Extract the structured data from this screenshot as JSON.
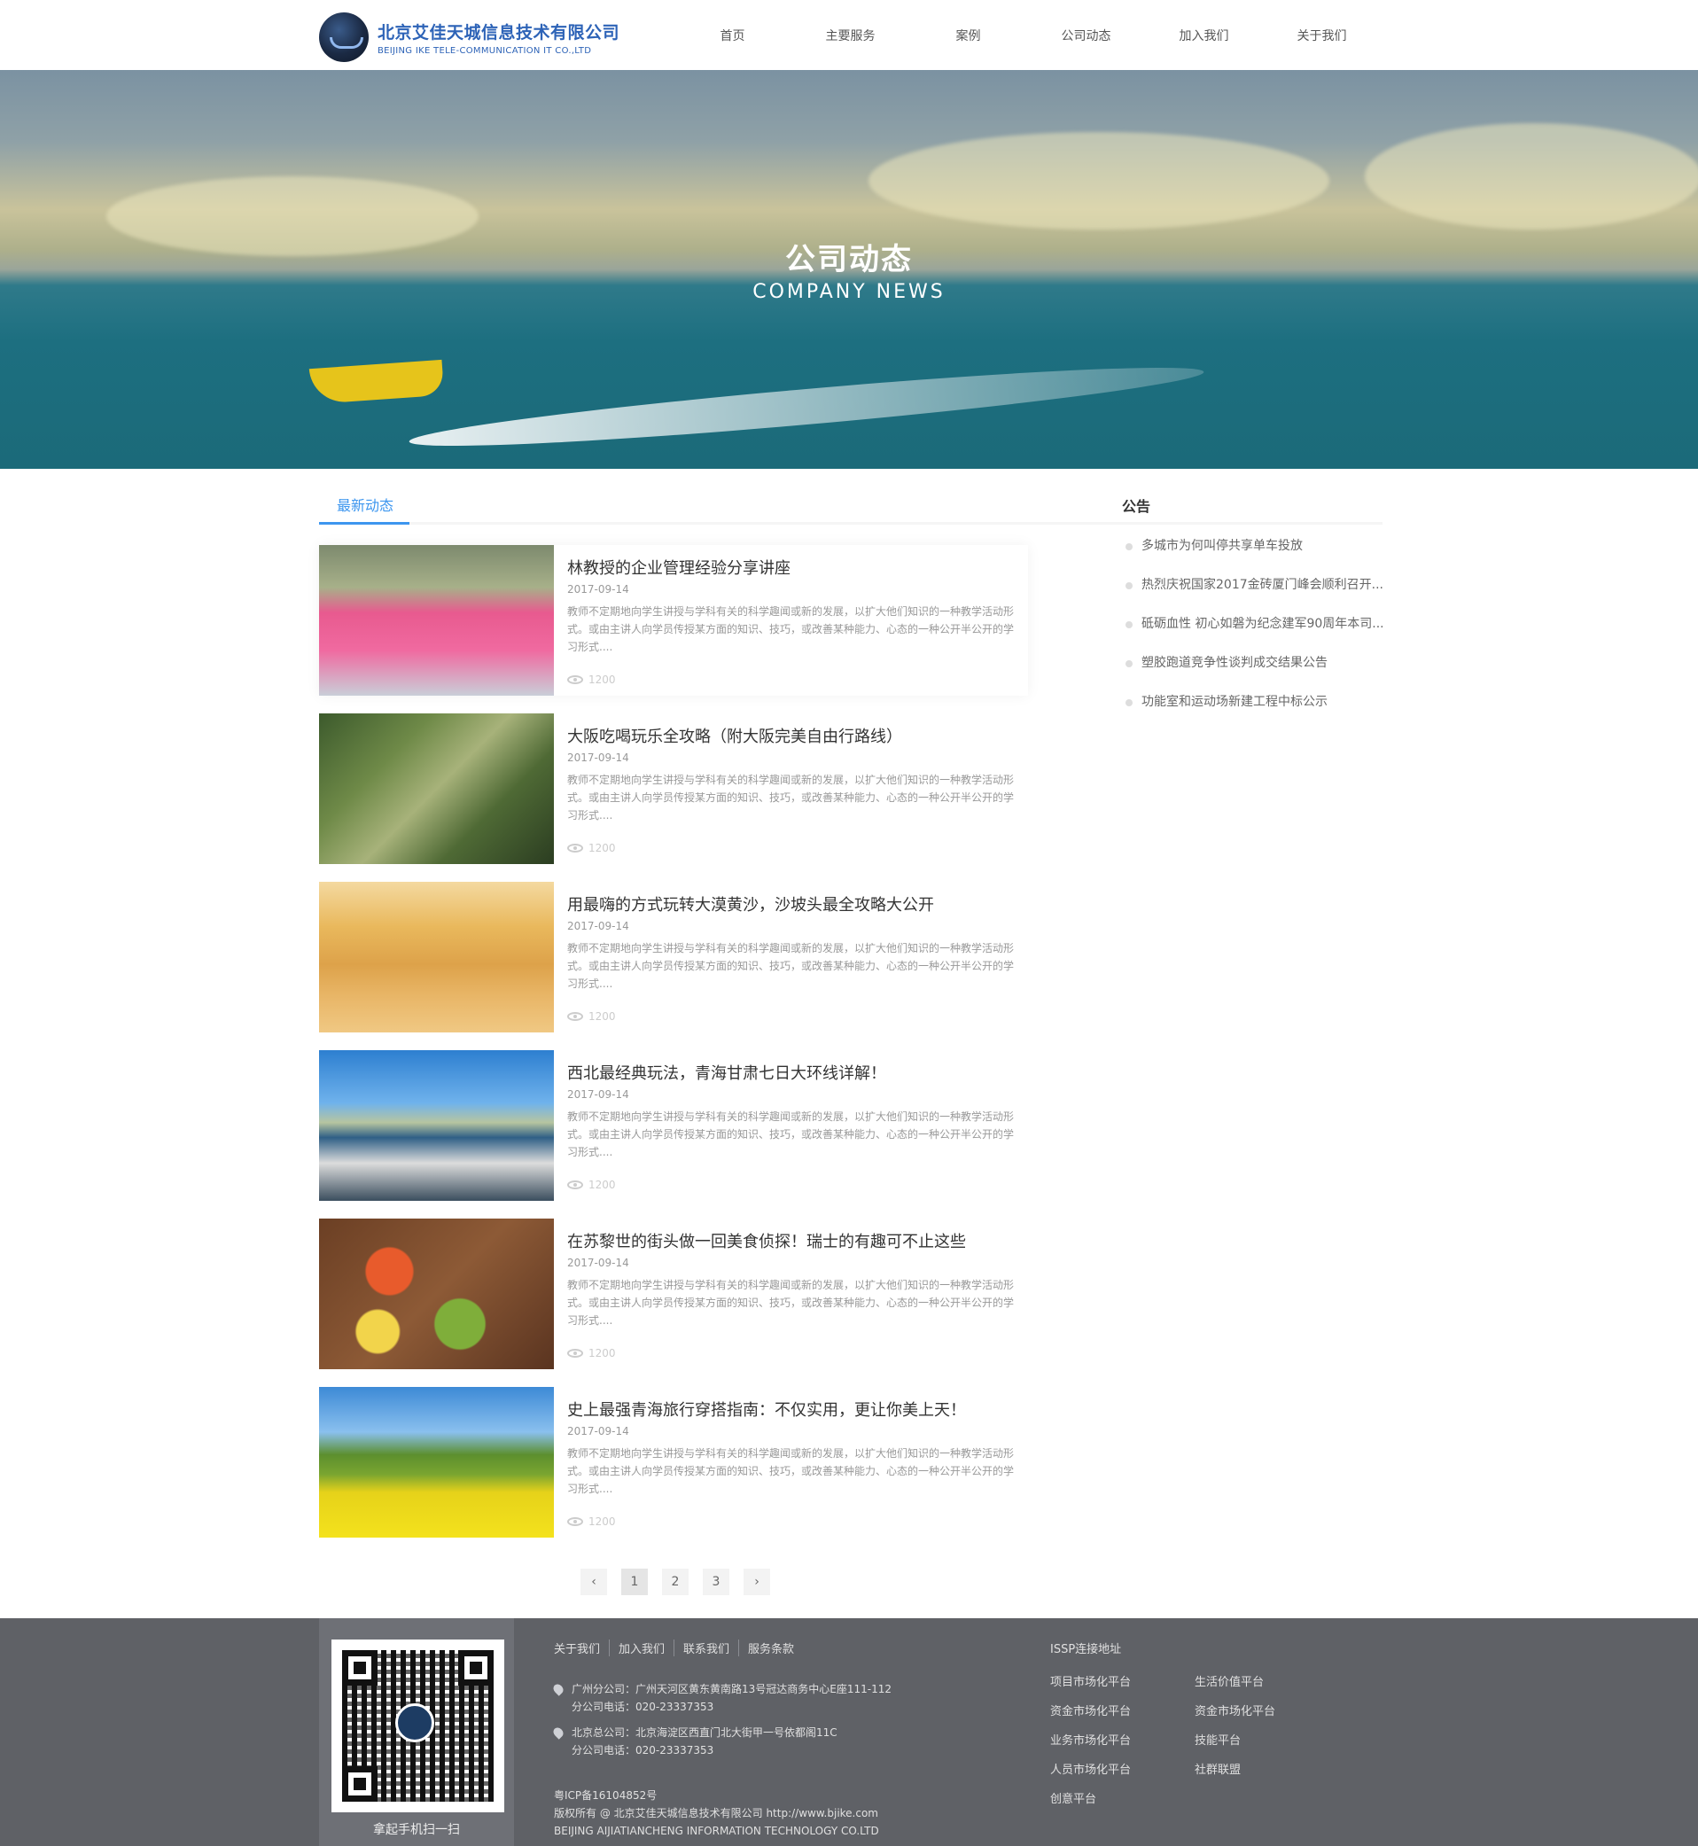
{
  "header": {
    "logo_cn": "北京艾佳天城信息技术有限公司",
    "logo_en": "BEIJING IKE TELE-COMMUNICATION IT CO.,LTD",
    "nav": [
      "首页",
      "主要服务",
      "案例",
      "公司动态",
      "加入我们",
      "关于我们"
    ]
  },
  "banner": {
    "title": "公司动态",
    "subtitle": "COMPANY NEWS"
  },
  "tabs": {
    "active": "最新动态"
  },
  "news": [
    {
      "title": "林教授的企业管理经验分享讲座",
      "date": "2017-09-14",
      "desc": "教师不定期地向学生讲授与学科有关的科学趣闻或新的发展，以扩大他们知识的一种教学活动形式。或由主讲人向学员传授某方面的知识、技巧，或改善某种能力、心态的一种公开半公开的学习形式....",
      "views": "1200"
    },
    {
      "title": "大阪吃喝玩乐全攻略（附大阪完美自由行路线）",
      "date": "2017-09-14",
      "desc": "教师不定期地向学生讲授与学科有关的科学趣闻或新的发展，以扩大他们知识的一种教学活动形式。或由主讲人向学员传授某方面的知识、技巧，或改善某种能力、心态的一种公开半公开的学习形式....",
      "views": "1200"
    },
    {
      "title": "用最嗨的方式玩转大漠黄沙，沙坡头最全攻略大公开",
      "date": "2017-09-14",
      "desc": "教师不定期地向学生讲授与学科有关的科学趣闻或新的发展，以扩大他们知识的一种教学活动形式。或由主讲人向学员传授某方面的知识、技巧，或改善某种能力、心态的一种公开半公开的学习形式....",
      "views": "1200"
    },
    {
      "title": "西北最经典玩法，青海甘肃七日大环线详解！",
      "date": "2017-09-14",
      "desc": "教师不定期地向学生讲授与学科有关的科学趣闻或新的发展，以扩大他们知识的一种教学活动形式。或由主讲人向学员传授某方面的知识、技巧，或改善某种能力、心态的一种公开半公开的学习形式....",
      "views": "1200"
    },
    {
      "title": "在苏黎世的街头做一回美食侦探！瑞士的有趣可不止这些",
      "date": "2017-09-14",
      "desc": "教师不定期地向学生讲授与学科有关的科学趣闻或新的发展，以扩大他们知识的一种教学活动形式。或由主讲人向学员传授某方面的知识、技巧，或改善某种能力、心态的一种公开半公开的学习形式....",
      "views": "1200"
    },
    {
      "title": "史上最强青海旅行穿搭指南：不仅实用，更让你美上天！",
      "date": "2017-09-14",
      "desc": "教师不定期地向学生讲授与学科有关的科学趣闻或新的发展，以扩大他们知识的一种教学活动形式。或由主讲人向学员传授某方面的知识、技巧，或改善某种能力、心态的一种公开半公开的学习形式....",
      "views": "1200"
    }
  ],
  "notice": {
    "title": "公告",
    "items": [
      "多城市为何叫停共享单车投放",
      "热烈庆祝国家2017金砖厦门峰会顺利召开...",
      "砥砺血性 初心如磐为纪念建军90周年本司...",
      "塑胶跑道竞争性谈判成交结果公告",
      "功能室和运动场新建工程中标公示"
    ]
  },
  "pager": {
    "prev": "‹",
    "pages": [
      "1",
      "2",
      "3"
    ],
    "next": "›"
  },
  "footer": {
    "qr_caption": "拿起手机扫一扫",
    "links": [
      "关于我们",
      "加入我们",
      "联系我们",
      "服务条款"
    ],
    "addr1_line1": "广州分公司：广州天河区黄东黄南路13号冠达商务中心E座111-112",
    "addr1_line2": "分公司电话：020-23337353",
    "addr2_line1": "北京总公司：北京海淀区西直门北大街甲一号依都阁11C",
    "addr2_line2": "分公司电话：020-23337353",
    "icp": "粤ICP备16104852号",
    "copyright": "版权所有 @ 北京艾佳天城信息技术有限公司 http://www.bjike.com",
    "company_en": "BEIJING AIJIATIANCHENG INFORMATION TECHNOLOGY CO.LTD",
    "issp_title": "ISSP连接地址",
    "issp_items": [
      "项目市场化平台",
      "生活价值平台",
      "资金市场化平台",
      "资金市场化平台",
      "业务市场化平台",
      "技能平台",
      "人员市场化平台",
      "社群联盟",
      "创意平台"
    ]
  }
}
